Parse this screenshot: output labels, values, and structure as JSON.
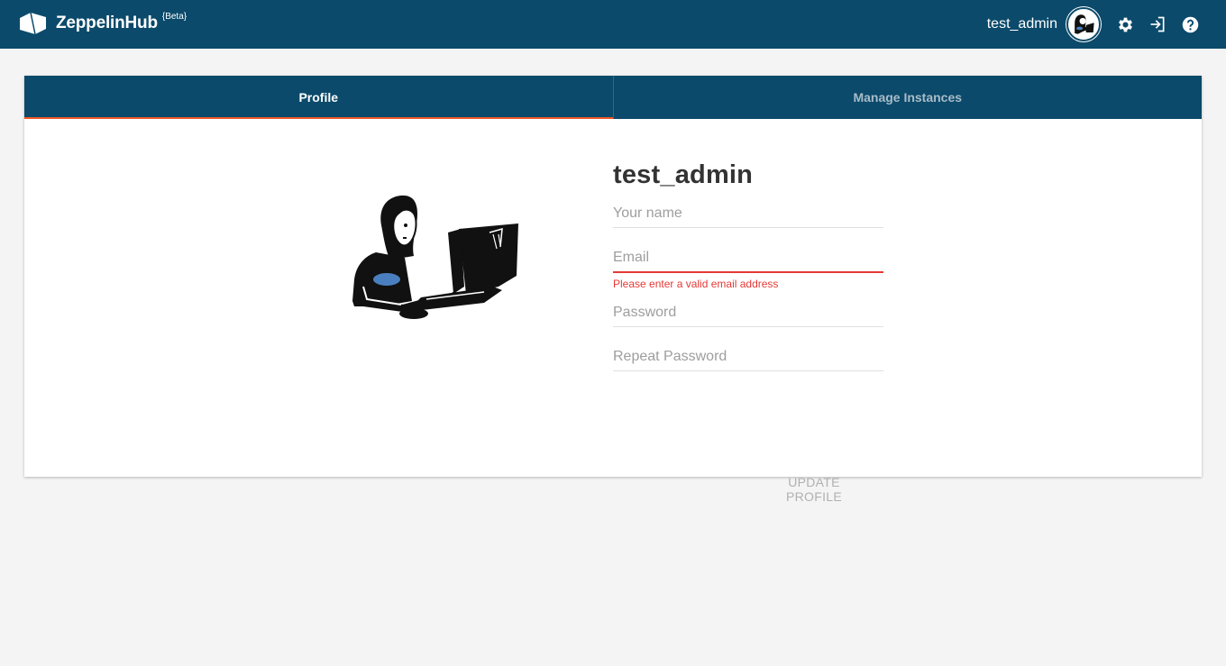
{
  "header": {
    "brand_bold": "Zeppelin",
    "brand_hub": "Hub",
    "beta": "{Beta}",
    "username": "test_admin",
    "icons": [
      "zeppelin-logo-icon",
      "avatar",
      "gear-icon",
      "logout-icon",
      "help-icon"
    ]
  },
  "tabs": [
    {
      "label": "Profile",
      "active": true
    },
    {
      "label": "Manage Instances",
      "active": false
    }
  ],
  "profile": {
    "username": "test_admin",
    "name_placeholder": "Your name",
    "email_placeholder": "Email",
    "email_error": "Please enter a valid email address",
    "password_placeholder": "Password",
    "repeat_password_placeholder": "Repeat Password",
    "update_label": "UPDATE PROFILE"
  },
  "colors": {
    "header_bg": "#0b4a6b",
    "tab_indicator": "#f05a28",
    "error": "#e53935",
    "page_bg": "#f4f4f4"
  }
}
